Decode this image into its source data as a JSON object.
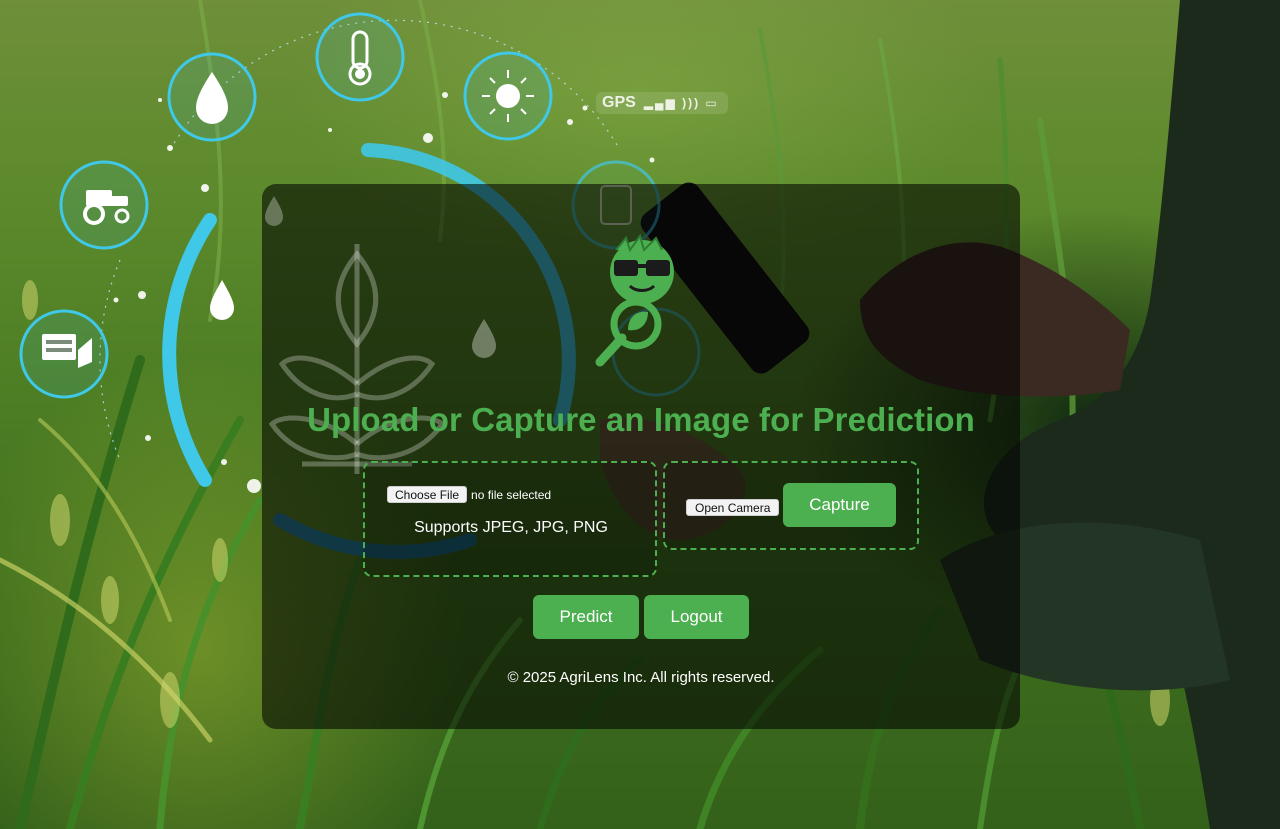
{
  "background": {
    "gps_label": "GPS",
    "gps_icons": "▂▄▆ ))) ▭"
  },
  "main": {
    "title": "Upload or Capture an Image for Prediction",
    "upload": {
      "choose_file_label": "Choose File",
      "file_status": "no file selected",
      "supports_text": "Supports JPEG, JPG, PNG"
    },
    "camera": {
      "open_camera_label": "Open Camera",
      "capture_label": "Capture"
    },
    "actions": {
      "predict_label": "Predict",
      "logout_label": "Logout"
    },
    "footer": "© 2025 AgriLens Inc. All rights reserved."
  },
  "colors": {
    "accent": "#4caf50",
    "tech_cyan": "#3fc8e8",
    "panel_overlay": "rgba(0,0,0,0.56)"
  },
  "icons": [
    "water-drop-icon",
    "thermometer-icon",
    "sun-icon",
    "tractor-icon",
    "ph-meter-icon",
    "soil-sample-icon",
    "plant-icon",
    "agrilens-logo-icon"
  ]
}
